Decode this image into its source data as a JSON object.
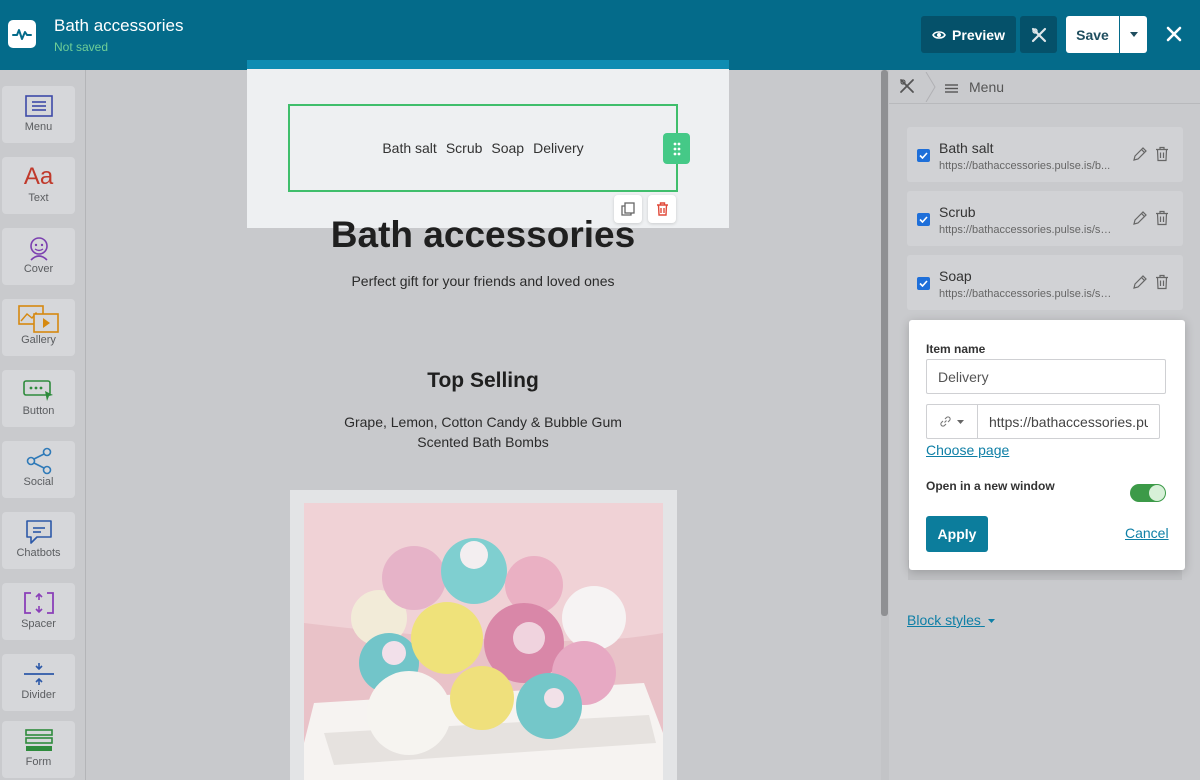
{
  "header": {
    "page_name": "Bath accessories",
    "save_status": "Not saved",
    "preview_label": "Preview",
    "save_label": "Save"
  },
  "sidebar": {
    "tools": [
      {
        "label": "Menu",
        "icon": "menu-block-icon"
      },
      {
        "label": "Text",
        "icon": "text-aa-icon"
      },
      {
        "label": "Cover",
        "icon": "cover-icon"
      },
      {
        "label": "Gallery",
        "icon": "gallery-icon"
      },
      {
        "label": "Button",
        "icon": "button-block-icon"
      },
      {
        "label": "Social",
        "icon": "social-share-icon"
      },
      {
        "label": "Chatbots",
        "icon": "chatbot-icon"
      },
      {
        "label": "Spacer",
        "icon": "spacer-icon"
      },
      {
        "label": "Divider",
        "icon": "divider-icon"
      },
      {
        "label": "Form",
        "icon": "form-icon"
      }
    ]
  },
  "canvas": {
    "menu_links": [
      "Bath salt",
      "Scrub",
      "Soap",
      "Delivery"
    ],
    "hero_title": "Bath accessories",
    "hero_subtitle": "Perfect gift for your friends and loved ones",
    "section_title": "Top Selling",
    "section_desc_line1": "Grape, Lemon, Cotton Candy & Bubble Gum",
    "section_desc_line2": "Scented Bath Bombs"
  },
  "right_panel": {
    "breadcrumb_label": "Menu",
    "menu_items": [
      {
        "name": "Bath salt",
        "url": "https://bathaccessories.pulse.is/b...",
        "checked": true
      },
      {
        "name": "Scrub",
        "url": "https://bathaccessories.pulse.is/sc...",
        "checked": true
      },
      {
        "name": "Soap",
        "url": "https://bathaccessories.pulse.is/so...",
        "checked": true
      }
    ],
    "edit_popup": {
      "item_name_label": "Item name",
      "item_name_value": "Delivery",
      "url_value": "https://bathaccessories.pu",
      "choose_page_label": "Choose page",
      "new_window_label": "Open in a new window",
      "new_window_on": true,
      "apply_label": "Apply",
      "cancel_label": "Cancel"
    },
    "block_styles_label": "Block styles"
  },
  "colors": {
    "topbar": "#046b8a",
    "accent_green": "#45c987",
    "link_blue": "#0e7fa6",
    "apply_button": "#0c7d9c"
  }
}
